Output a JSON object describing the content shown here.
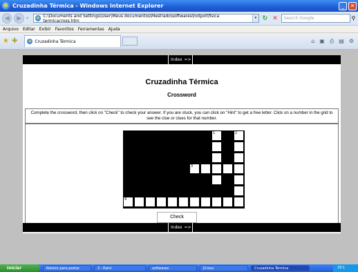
{
  "window": {
    "title": "Cruzadinha Térmica - Windows Internet Explorer"
  },
  "address": {
    "url": "C:\\Documents and Settings\\User\\Meus documentos\\Mestrado\\softwares\\hotpot\\fisica termicacross.htm"
  },
  "search": {
    "placeholder": "Search Google"
  },
  "menu": [
    "Arquivo",
    "Editar",
    "Exibir",
    "Favoritos",
    "Ferramentas",
    "Ajuda"
  ],
  "tab": {
    "label": "Cruzadinha Térmica"
  },
  "nav": {
    "index_label": "Index",
    "arrow": "=>"
  },
  "page": {
    "title": "Cruzadinha Térmica",
    "subtitle": "Crossword",
    "instructions": "Complete the crossword, then click on \"Check\" to check your answer. If you are stuck, you can click on \"Hint\" to get a free letter. Click on a number in the grid to see the clue or clues for that number.",
    "check_label": "Check"
  },
  "grid": {
    "rows": 8,
    "cols": 11,
    "white_cells": [
      [
        0,
        8
      ],
      [
        0,
        10
      ],
      [
        1,
        8
      ],
      [
        1,
        10
      ],
      [
        2,
        8
      ],
      [
        2,
        10
      ],
      [
        3,
        6
      ],
      [
        3,
        7
      ],
      [
        3,
        8
      ],
      [
        3,
        9
      ],
      [
        3,
        10
      ],
      [
        4,
        8
      ],
      [
        4,
        10
      ],
      [
        5,
        10
      ],
      [
        6,
        0
      ],
      [
        6,
        1
      ],
      [
        6,
        2
      ],
      [
        6,
        3
      ],
      [
        6,
        4
      ],
      [
        6,
        5
      ],
      [
        6,
        6
      ],
      [
        6,
        7
      ],
      [
        6,
        8
      ],
      [
        6,
        9
      ],
      [
        6,
        10
      ]
    ],
    "numbers": [
      {
        "row": 0,
        "col": 8,
        "n": "1"
      },
      {
        "row": 0,
        "col": 10,
        "n": "2"
      },
      {
        "row": 3,
        "col": 6,
        "n": "3"
      },
      {
        "row": 6,
        "col": 0,
        "n": "4"
      }
    ]
  },
  "taskbar": {
    "start": "Iniciar",
    "tasks": [
      "Roteiro para postar",
      "3 - Paint",
      "softwares",
      "JCross",
      "Cruzadinha Térmica"
    ],
    "clock": "18:1"
  }
}
